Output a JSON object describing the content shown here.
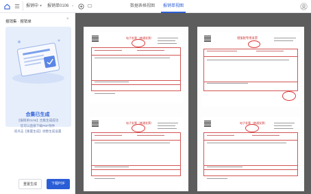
{
  "topbar": {
    "home_icon": "home-icon",
    "list_icon": "list-icon",
    "crumb_reimbursing": "报销中",
    "crumb_doc": "报销单0106",
    "add_icon": "plus-circle-icon",
    "tabs": [
      {
        "label": "数据表格视图",
        "active": false
      },
      {
        "label": "报销单视图",
        "active": true
      }
    ],
    "avatar_icon": "user-icon"
  },
  "left": {
    "breadcrumb": "报销集 · 报销单",
    "close_icon": "close-icon",
    "heading": "合集已生成",
    "lines": [
      "【报销单0106】合集生成成功",
      "您可以直接下载PDF附件",
      "或点击【重置生成】调整生成设置"
    ],
    "reset_button": "重置生成",
    "download_button": "下载PDF"
  },
  "invoices": {
    "normal_title": "电子发票（普通发票）",
    "special_title": "增值税专用发票"
  },
  "accent": "#2b5ed6"
}
